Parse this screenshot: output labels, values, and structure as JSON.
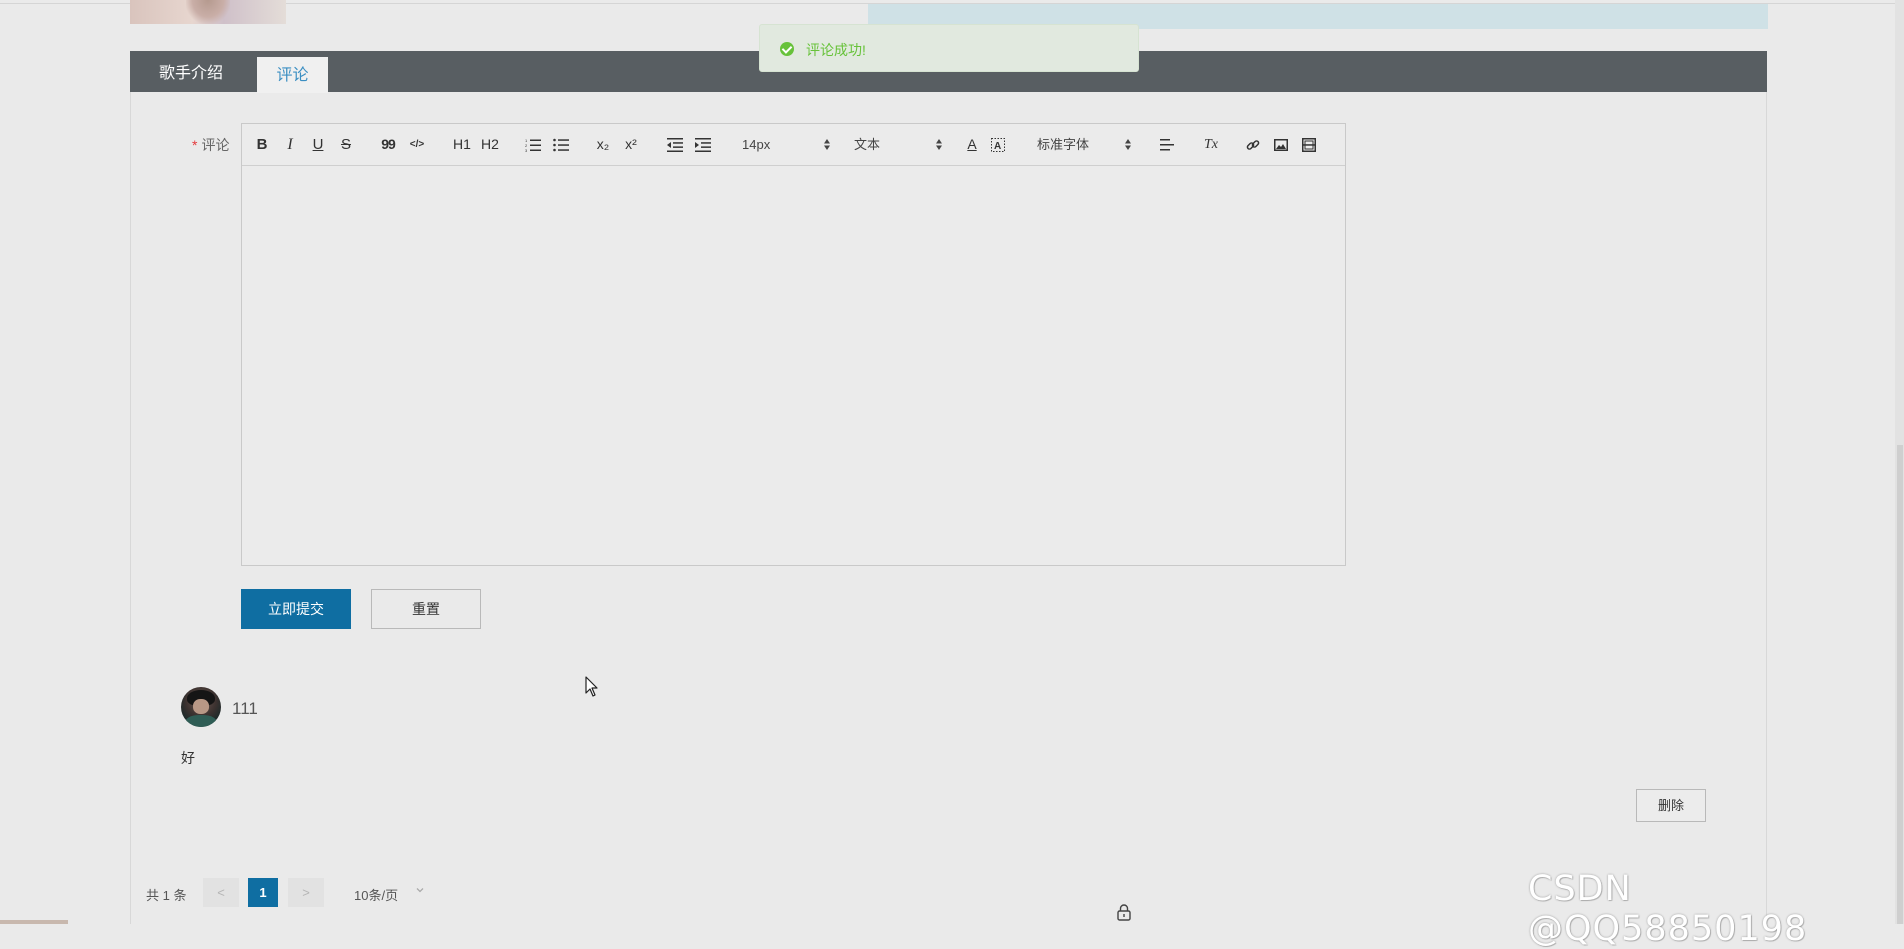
{
  "tabs": {
    "intro_label": "歌手介绍",
    "comment_label": "评论"
  },
  "form": {
    "required_mark": "*",
    "comment_label": "评论",
    "submit_label": "立即提交",
    "reset_label": "重置"
  },
  "toolbar": {
    "font_size_value": "14px",
    "paragraph_value": "文本",
    "font_family_value": "标准字体",
    "bold_glyph": "B",
    "italic_glyph": "I",
    "underline_glyph": "U",
    "strike_glyph": "S",
    "quote_glyph": "99",
    "code_glyph": "</>",
    "h1_glyph": "H1",
    "h2_glyph": "H2",
    "sub_glyph": "x₂",
    "sup_glyph": "x²",
    "color_glyph": "A",
    "clear_glyph": "Tx"
  },
  "toast": {
    "message": "评论成功!",
    "color": "#67c23a"
  },
  "comment": {
    "username": "111",
    "text": "好",
    "delete_label": "删除"
  },
  "pagination": {
    "total_label": "共 1 条",
    "prev_label": "<",
    "current_page": "1",
    "next_label": ">",
    "page_size_label": "10条/页"
  },
  "watermark": "CSDN @QQ58850198",
  "colors": {
    "primary": "#0f6ea2",
    "tab_bar": "#585e62",
    "tab_active_text": "#3a8ec2",
    "success": "#67c23a"
  }
}
